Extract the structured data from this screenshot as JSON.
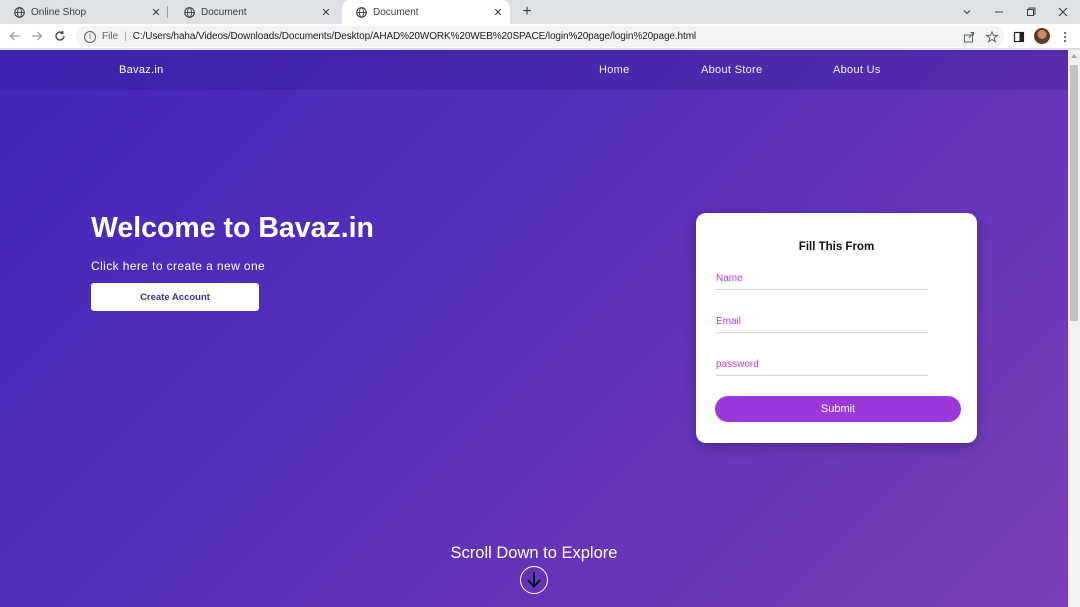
{
  "browser": {
    "tabs": [
      {
        "title": "Online Shop",
        "active": false
      },
      {
        "title": "Document",
        "active": false
      },
      {
        "title": "Document",
        "active": true
      }
    ],
    "address": {
      "scheme_label": "File",
      "url": "C:/Users/haha/Videos/Downloads/Documents/Desktop/AHAD%20WORK%20WEB%20SPACE/login%20page/login%20page.html"
    }
  },
  "navbar": {
    "brand": "Bavaz.in",
    "links": [
      "Home",
      "About Store",
      "About Us"
    ]
  },
  "hero": {
    "title": "Welcome to Bavaz.in",
    "subtitle": "Click here to create a new one",
    "button_label": "Create Account"
  },
  "form": {
    "title": "Fill This From",
    "fields": [
      {
        "placeholder": "Name",
        "value": ""
      },
      {
        "placeholder": "Email",
        "value": ""
      },
      {
        "placeholder": "password",
        "value": ""
      }
    ],
    "submit_label": "Submit"
  },
  "scroll": {
    "text": "Scroll Down to Explore"
  },
  "colors": {
    "bg_start": "#4327b8",
    "bg_end": "#7a3fb6",
    "submit": "#9b38dc",
    "placeholder": "#b03fd0"
  }
}
